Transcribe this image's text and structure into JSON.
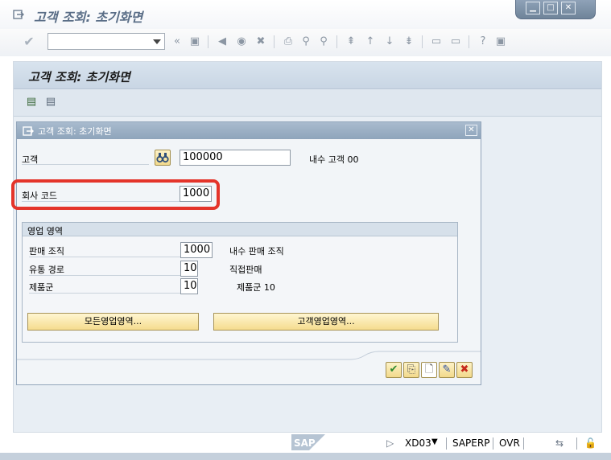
{
  "window": {
    "title": "고객 조회: 초기화면",
    "controls": [
      "minimize",
      "maximize",
      "close"
    ]
  },
  "page": {
    "title": "고객 조회: 초기화면"
  },
  "dialog": {
    "title": "고객 조회: 초기화면",
    "customer": {
      "label": "고객",
      "value": "100000",
      "description": "내수 고객 00"
    },
    "company_code": {
      "label": "회사 코드",
      "value": "1000"
    },
    "sales_area": {
      "title": "영업 영역",
      "sales_org": {
        "label": "판매 조직",
        "value": "1000",
        "description": "내수 판매 조직"
      },
      "distribution_channel": {
        "label": "유통 경로",
        "value": "10",
        "description": "직접판매"
      },
      "division": {
        "label": "제품군",
        "value": "10",
        "description": "제품군 10"
      },
      "all_sales_areas_button": "모든영업영역...",
      "customer_sales_areas_button": "고객영업영역..."
    }
  },
  "status": {
    "transaction": "XD03",
    "system": "SAPERP",
    "mode": "OVR",
    "logo": "SAP"
  },
  "colors": {
    "accent": "#5a6e87",
    "highlight": "#e4342a"
  }
}
